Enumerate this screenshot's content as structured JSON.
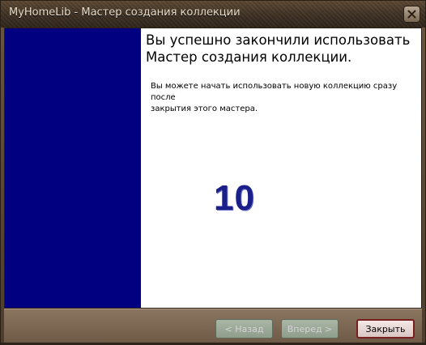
{
  "window": {
    "title": "MyHomeLib - Мастер создания коллекции",
    "close_icon": "close-icon"
  },
  "content": {
    "heading_line1": "Вы успешно закончили использовать",
    "heading_line2": "Мастер создания коллекции.",
    "message_line1": "Вы можете начать использовать новую коллекцию сразу после",
    "message_line2": "закрытия этого мастера.",
    "watermark_number": "10",
    "sidebar_color": "#000080"
  },
  "buttons": {
    "back_label": "< Назад",
    "next_label": "Вперед >",
    "close_label": "Закрыть"
  }
}
